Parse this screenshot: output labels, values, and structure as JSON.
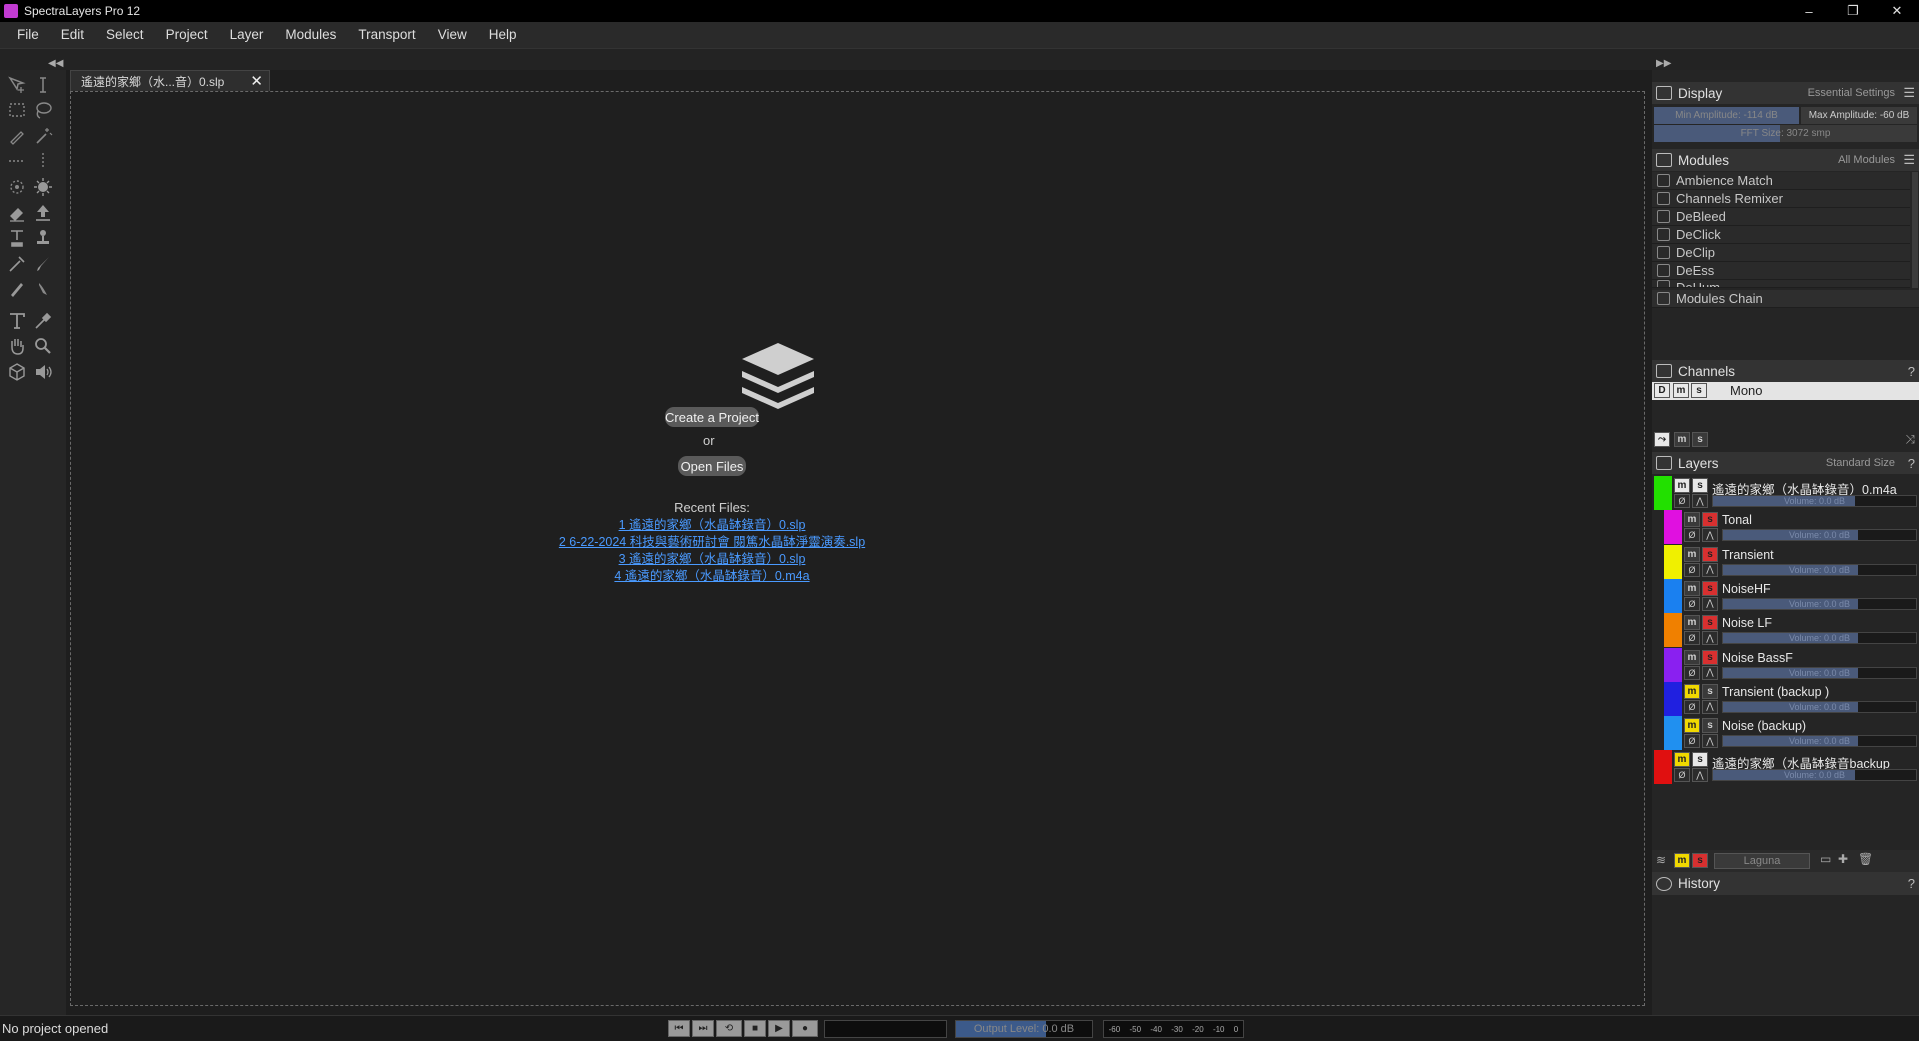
{
  "window": {
    "title": "SpectraLayers Pro 12",
    "minimize": "–",
    "restore": "❐",
    "close": "✕"
  },
  "menu": [
    "File",
    "Edit",
    "Select",
    "Project",
    "Layer",
    "Modules",
    "Transport",
    "View",
    "Help"
  ],
  "doc_tab": {
    "label": "遙遠的家鄉（水...音）0.slp",
    "close": "✕"
  },
  "welcome": {
    "create_project": "Create a Project",
    "or": "or",
    "open_files": "Open Files",
    "recent_title": "Recent Files:",
    "recent_files": [
      "1 遙遠的家鄉（水晶缽錄音）0.slp",
      "2 6-22-2024 科技與藝術研討會 閱篤水晶缽淨靈演奏.slp",
      "3 遙遠的家鄉（水晶缽錄音）0.slp",
      "4 遙遠的家鄉（水晶缽錄音）0.m4a"
    ]
  },
  "display": {
    "title": "Display",
    "preset": "Essential Settings",
    "min_amplitude": "Min Amplitude: -114 dB",
    "max_amplitude": "Max Amplitude: -60 dB",
    "fft_size": "FFT Size: 3072 smp"
  },
  "modules": {
    "title": "Modules",
    "filter": "All Modules",
    "items": [
      "Ambience Match",
      "Channels Remixer",
      "DeBleed",
      "DeClick",
      "DeClip",
      "DeEss",
      "DeHum"
    ],
    "chain": "Modules Chain"
  },
  "channels": {
    "title": "Channels",
    "help": "?",
    "d": "D",
    "m": "m",
    "s": "s",
    "name": "Mono"
  },
  "layers": {
    "title": "Layers",
    "size": "Standard Size",
    "help": "?",
    "volume_label": "Volume: 0.0 dB",
    "items": [
      {
        "name": "遙遠的家鄉（水晶缽錄音）0.m4a",
        "color": "#22e000",
        "level": 0,
        "m": "m",
        "s": "s"
      },
      {
        "name": "Tonal",
        "color": "#e010e0",
        "level": 1,
        "m": "m",
        "s": "s"
      },
      {
        "name": "Transient",
        "color": "#f0f000",
        "level": 1,
        "m": "m",
        "s": "s"
      },
      {
        "name": "NoiseHF",
        "color": "#1a80f0",
        "level": 1,
        "m": "m",
        "s": "s"
      },
      {
        "name": "Noise LF",
        "color": "#f08000",
        "level": 1,
        "m": "m",
        "s": "s"
      },
      {
        "name": "Noise BassF",
        "color": "#8a20f0",
        "level": 1,
        "m": "m",
        "s": "s"
      },
      {
        "name": "Transient (backup )",
        "color": "#2020e0",
        "level": 1,
        "m": "m",
        "s": "s"
      },
      {
        "name": "Noise (backup)",
        "color": "#2090f0",
        "level": 1,
        "m": "m",
        "s": "s"
      },
      {
        "name": "遙遠的家鄉（水晶缽錄音backup",
        "color": "#e01010",
        "level": 0,
        "m": "m",
        "s": "s"
      }
    ],
    "footer_m": "m",
    "footer_s": "s",
    "blend_mode": "Laguna"
  },
  "history": {
    "title": "History",
    "help": "?"
  },
  "status": {
    "text": "No project opened",
    "output_level": "Output Level: 0.0 dB",
    "meter_ticks": [
      "-60",
      "-50",
      "-40",
      "-30",
      "-20",
      "-10",
      "0"
    ]
  }
}
